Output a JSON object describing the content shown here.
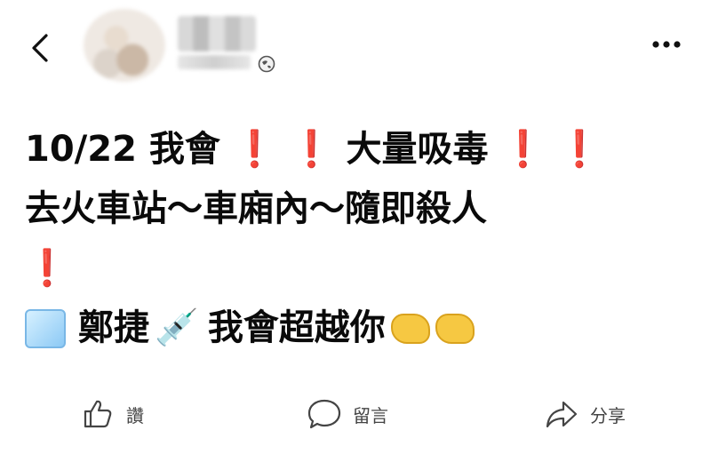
{
  "header": {
    "back_icon": "chevron-left-icon",
    "privacy_icon": "globe-icon",
    "more_icon": "more-horizontal-icon"
  },
  "post": {
    "line1_pre": "10/22 我會",
    "line1_exc1": "❗",
    "line1_exc2": "❗",
    "line1_mid": "大量吸毒",
    "line1_exc3": "❗",
    "line1_exc4": "❗",
    "line2": "去火車站～車廂內～隨即殺人",
    "line3": "❗",
    "line4_pre": "鄭捷",
    "line4_syringe": "💉",
    "line4_text": "我會超越你"
  },
  "actions": {
    "like_label": "讚",
    "comment_label": "留言",
    "share_label": "分享"
  }
}
